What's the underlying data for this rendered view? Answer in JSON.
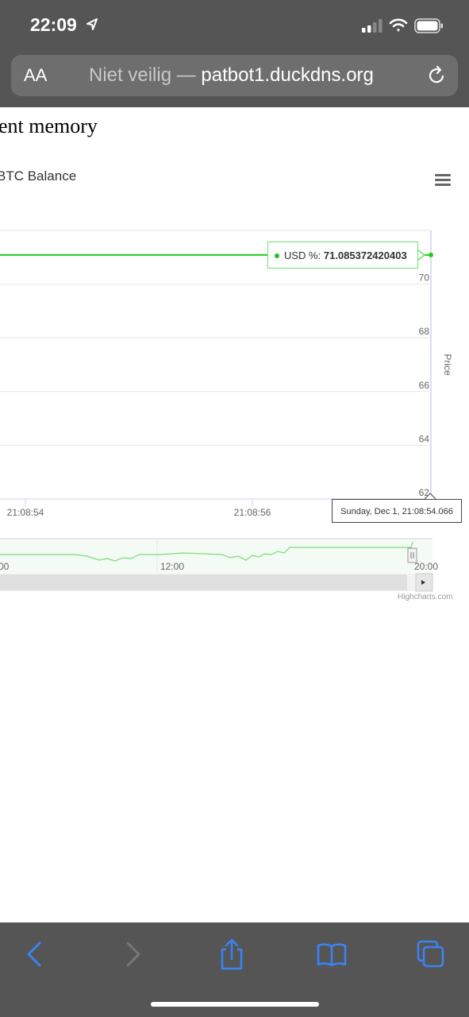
{
  "status_bar": {
    "time": "22:09"
  },
  "browser": {
    "text_size_label": "AA",
    "security_text": "Niet veilig —",
    "domain": "patbot1.duckdns.org"
  },
  "page": {
    "heading": "ent memory"
  },
  "chart": {
    "title": "BTC Balance",
    "credit": "Highcharts.com",
    "y_axis_title": "Price",
    "tooltip": {
      "series_label": "USD %:",
      "value": "71.085372420403"
    },
    "date_flag": "Sunday, Dec 1, 21:08:54.066",
    "series_color": "#22cc22",
    "navigator_labels": [
      "00",
      "12:00",
      "20:00"
    ]
  },
  "chart_data": {
    "type": "line",
    "title": "BTC Balance",
    "ylabel": "Price",
    "x_tick_labels": [
      "21:08:54",
      "21:08:56"
    ],
    "y_tick_labels": [
      "62",
      "64",
      "66",
      "68",
      "70"
    ],
    "ylim": [
      62,
      72
    ],
    "series": [
      {
        "name": "USD %",
        "x": [
          "21:08:54",
          "21:08:56"
        ],
        "values": [
          71.085372420403,
          71.085372420403
        ]
      }
    ]
  }
}
